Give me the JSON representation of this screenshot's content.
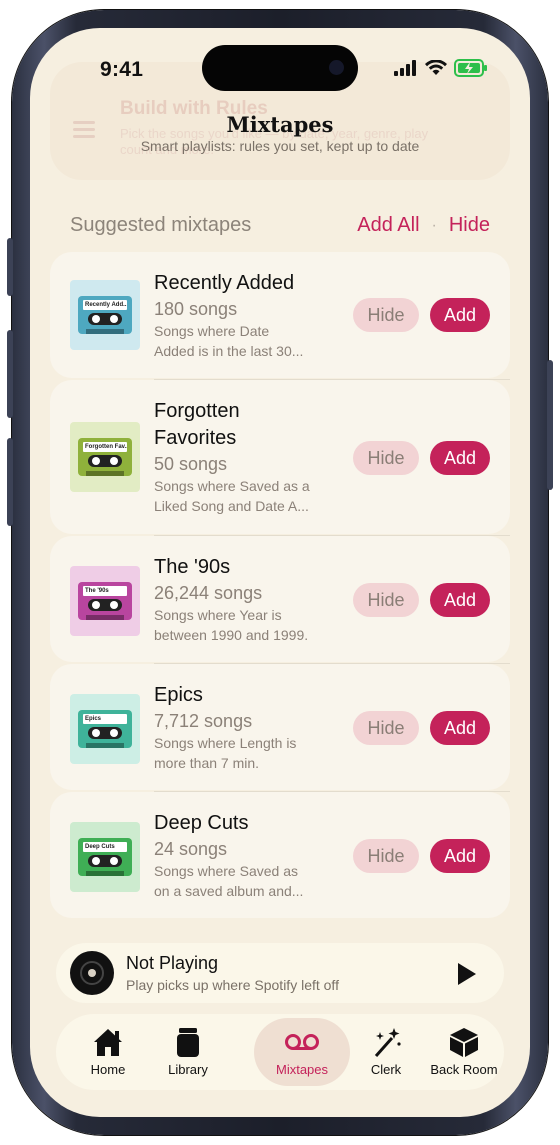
{
  "status": {
    "time": "9:41"
  },
  "colors": {
    "accent": "#c4225a",
    "background": "#f6efe0",
    "hide_button": "#f2d3d4",
    "battery": "#2dbf4a"
  },
  "background_card": {
    "title": "Build with Rules",
    "description": "Pick the songs you'd like — by date, year, genre, play count and more."
  },
  "header": {
    "title": "Mixtapes",
    "subtitle": "Smart playlists: rules you set, kept up to date"
  },
  "suggestions": {
    "section_title": "Suggested mixtapes",
    "add_all_label": "Add All",
    "separator": "·",
    "hide_all_label": "Hide",
    "hide_label": "Hide",
    "add_label": "Add",
    "items": [
      {
        "name": "Recently Added",
        "tape_label": "Recently Add...",
        "count": "180 songs",
        "desc_line1": "Songs where Date",
        "desc_line2": "Added is in the last 30...",
        "color": "#4ea8c0",
        "bg": "#cfe9ef",
        "icon": "cassette-icon"
      },
      {
        "name_line1": "Forgotten",
        "name_line2": "Favorites",
        "tape_label": "Forgotten Fav...",
        "count": "50 songs",
        "desc_line1": "Songs where Saved as a",
        "desc_line2": "Liked Song and Date A...",
        "color": "#8fb13b",
        "bg": "#e2ecc4",
        "icon": "cassette-icon"
      },
      {
        "name": "The '90s",
        "tape_label": "The '90s",
        "count": "26,244 songs",
        "desc_line1": "Songs where Year is",
        "desc_line2": "between 1990 and 1999.",
        "color": "#b9459f",
        "bg": "#efcde6",
        "icon": "cassette-icon"
      },
      {
        "name": "Epics",
        "tape_label": "Epics",
        "count": "7,712 songs",
        "desc_line1": "Songs where Length is",
        "desc_line2": "more than 7 min.",
        "color": "#3fb39a",
        "bg": "#cdeee5",
        "icon": "cassette-icon"
      },
      {
        "name": "Deep Cuts",
        "tape_label": "Deep Cuts",
        "count": "24 songs",
        "desc_line1": "Songs where Saved as",
        "desc_line2": "on a saved album and...",
        "color": "#3fae55",
        "bg": "#cdebcf",
        "icon": "cassette-icon"
      }
    ]
  },
  "now_playing": {
    "title": "Not Playing",
    "subtitle": "Play picks up where Spotify left off"
  },
  "tabs": [
    {
      "label": "Home",
      "icon": "house-icon"
    },
    {
      "label": "Library",
      "icon": "jar-icon"
    },
    {
      "label": "Mixtapes",
      "icon": "voicemail-icon",
      "active": true
    },
    {
      "label": "Clerk",
      "icon": "magic-wand-icon"
    },
    {
      "label": "Back Room",
      "icon": "box-icon"
    }
  ]
}
